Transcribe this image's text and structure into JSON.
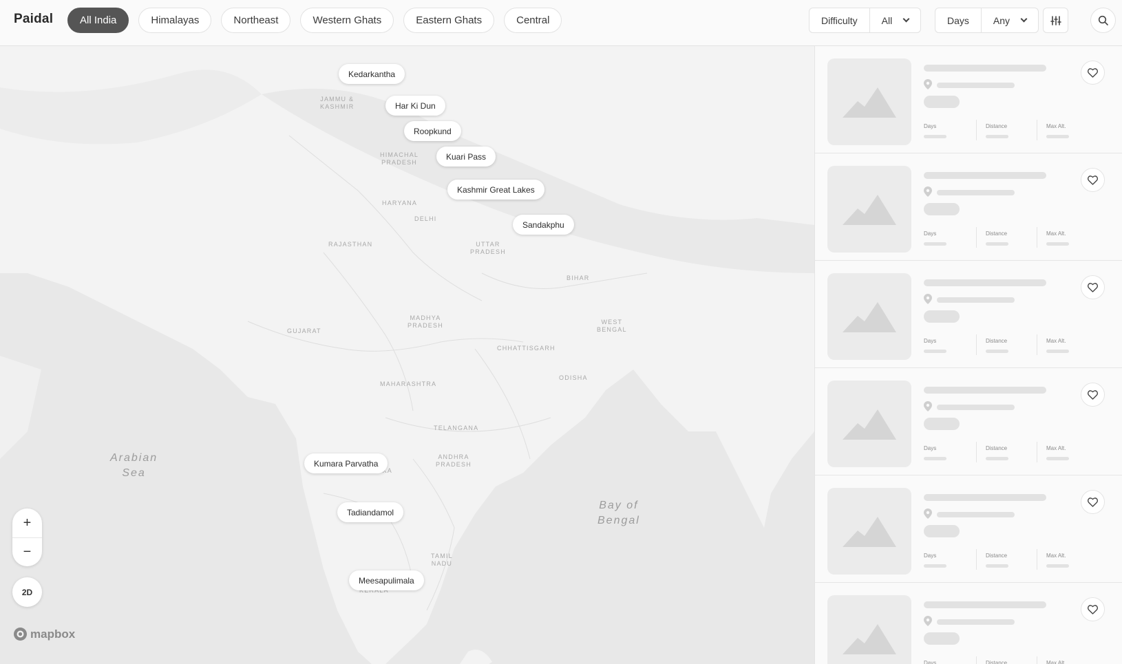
{
  "app": {
    "name": "Paidal"
  },
  "tabs": [
    {
      "label": "All India",
      "active": true
    },
    {
      "label": "Himalayas"
    },
    {
      "label": "Northeast"
    },
    {
      "label": "Western Ghats"
    },
    {
      "label": "Eastern Ghats"
    },
    {
      "label": "Central"
    }
  ],
  "filters": {
    "difficulty": {
      "label": "Difficulty",
      "value": "All"
    },
    "days": {
      "label": "Days",
      "value": "Any"
    }
  },
  "toolbar_icons": {
    "filters": "sliders-icon",
    "search": "search-icon"
  },
  "map": {
    "seas": {
      "arabian": [
        "Arabian",
        "Sea"
      ],
      "bengal": [
        "Bay of",
        "Bengal"
      ]
    },
    "regions": {
      "jk": [
        "JAMMU &",
        "KASHMIR"
      ],
      "hp": [
        "HIMACHAL",
        "PRADESH"
      ],
      "haryana": [
        "HARYANA"
      ],
      "delhi": [
        "DELHI"
      ],
      "rajasthan": [
        "RAJASTHAN"
      ],
      "up": [
        "UTTAR",
        "PRADESH"
      ],
      "bihar": [
        "BIHAR"
      ],
      "mp": [
        "MADHYA",
        "PRADESH"
      ],
      "gujarat": [
        "GUJARAT"
      ],
      "wb": [
        "WEST",
        "BENGAL"
      ],
      "chhattisgarh": [
        "CHHATTISGARH"
      ],
      "odisha": [
        "ODISHA"
      ],
      "maharashtra": [
        "MAHARASHTRA"
      ],
      "telangana": [
        "TELANGANA"
      ],
      "ap": [
        "ANDHRA",
        "PRADESH"
      ],
      "karnataka": [
        "KARNATAKA"
      ],
      "tn": [
        "TAMIL",
        "NADU"
      ],
      "kerala": [
        "KERALA"
      ]
    },
    "treks": {
      "kedarkantha": "Kedarkantha",
      "harkidun": "Har Ki Dun",
      "roopkund": "Roopkund",
      "kuari": "Kuari Pass",
      "kashmir": "Kashmir Great Lakes",
      "sandakphu": "Sandakphu",
      "kumara": "Kumara Parvatha",
      "tadiandamol": "Tadiandamol",
      "meesapulimala": "Meesapulimala"
    },
    "controls": {
      "zoom_in": "+",
      "zoom_out": "−",
      "view_mode": "2D"
    },
    "attribution": "mapbox"
  },
  "results": {
    "stat_labels": {
      "days": "Days",
      "distance": "Distance",
      "max_alt": "Max Alt."
    },
    "placeholder_count": 6
  }
}
